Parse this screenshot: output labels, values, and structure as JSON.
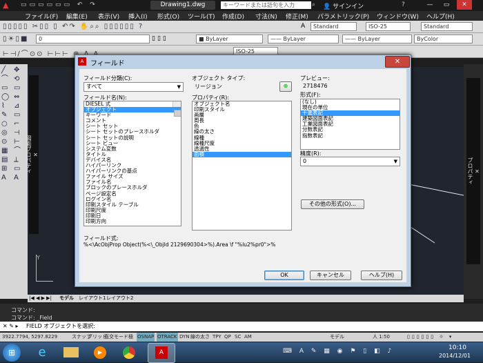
{
  "titlebar": {
    "doc_tab": "Drawing1.dwg",
    "search_placeholder": "キーワードまたは語句を入力",
    "user": "サインイン"
  },
  "menu": [
    "ファイル(F)",
    "編集(E)",
    "表示(V)",
    "挿入(I)",
    "形式(O)",
    "ツール(T)",
    "作成(D)",
    "寸法(N)",
    "修正(M)",
    "パラメトリック(P)",
    "ウィンドウ(W)",
    "ヘルプ(H)"
  ],
  "toolbars": {
    "text_style": "Standard",
    "dim_style": "ISO-25",
    "table_style": "Standard",
    "layer": "0",
    "color": "ByLayer",
    "linetype": "ByLayer",
    "lineweight": "ByLayer",
    "plotstyle": "ByColor",
    "dim_style2": "ISO-25"
  },
  "side_palette_label": "図面プロパティ",
  "right_palette_label": "プロパティ",
  "layout_tabs": [
    "モデル",
    "レイアウト1",
    "レイアウト2"
  ],
  "command_history": [
    "コマンド:",
    "コマンド: _Field"
  ],
  "command_prompt": "FIELD オブジェクトを選択:",
  "status": {
    "coords": "3922.7794, 5297.8229",
    "toggles": [
      "スナップ",
      "グリッド",
      "直交モード",
      "極",
      "OSNAP",
      "OTRACK",
      "DYN",
      "線の太さ",
      "TPY",
      "QP",
      "SC",
      "AM"
    ],
    "model_label": "モデル",
    "scale": "人 1:50"
  },
  "clock": {
    "time": "10:10",
    "date": "2014/12/01"
  },
  "dialog": {
    "title": "フィールド",
    "category_label": "フィールド分類(C):",
    "category_value": "すべて",
    "names_label": "フィールド名(N):",
    "names": [
      "DIESEL 式",
      "オブジェクト",
      "キーワード",
      "コメント",
      "シート セット",
      "シート セットのプレースホルダ",
      "シート セットの説明",
      "シート ビュー",
      "システム変数",
      "タイトル",
      "デバイス名",
      "ハイパーリンク",
      "ハイパーリンクの基点",
      "ファイル サイズ",
      "ファイル名",
      "ブロックのプレースホルダ",
      "ページ設定名",
      "ログイン名",
      "印刷スタイル テーブル",
      "印刷尺度",
      "印刷日",
      "印刷方向"
    ],
    "names_selected": 1,
    "object_type_label": "オブジェクト タイプ:",
    "object_type_value": "リージョン",
    "property_label": "プロパティ(R):",
    "properties": [
      "オブジェクト名",
      "印刷スタイル",
      "画層",
      "周長",
      "色",
      "線の太さ",
      "線種",
      "線種尺度",
      "透過性",
      "面積"
    ],
    "properties_selected": 9,
    "preview_label": "プレビュー:",
    "preview_value": "2718476",
    "format_label": "形式(F):",
    "formats": [
      "(なし)",
      "現在の単位",
      "十進表記",
      "建築図面表記",
      "工業図面表記",
      "分数表記",
      "指数表記"
    ],
    "formats_selected": 2,
    "precision_label": "精度(R):",
    "precision_value": "0",
    "other_format_button": "その他の形式(O)...",
    "expression_label": "フィールド式:",
    "expression_value": "%<\\AcObjProp Object(%<\\_ObjId 2129690304>%).Area \\f \"%lu2%pr0\">%",
    "ok": "OK",
    "cancel": "キャンセル",
    "help": "ヘルプ(H)"
  },
  "colors": {
    "accent": "#3399ff",
    "dialog_frame": "#bcd0e6",
    "drawing_bg": "#20252e"
  }
}
